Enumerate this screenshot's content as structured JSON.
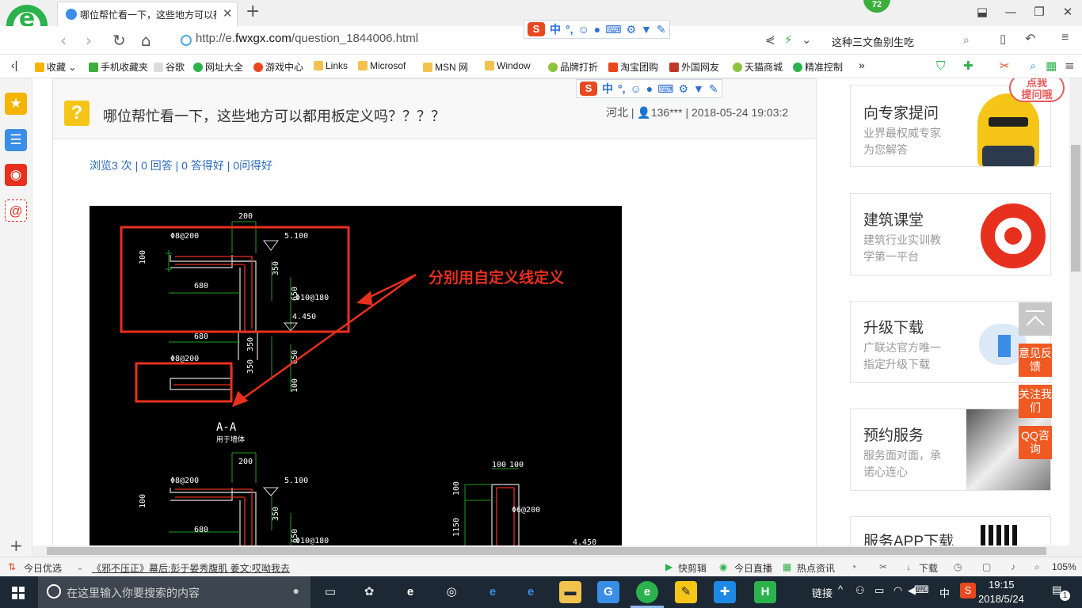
{
  "browser": {
    "tab_title": "哪位帮忙看一下，这些地方可以都用板定义吗？？？？",
    "tab_close": "✕",
    "new_tab": "+",
    "badge_count": "72",
    "url_scheme": "http://e.",
    "url_domain": "fwxgx.com",
    "url_path": "/question_1844006.html",
    "search_text": "这种三文鱼别生吃",
    "window_controls": [
      "⬓",
      "—",
      "❐",
      "✕"
    ]
  },
  "ime": {
    "logo": "S",
    "lang": "中",
    "punct": "°,",
    "icons": [
      "☺",
      "🎤",
      "⌨",
      "⚙",
      "👕",
      "🔧"
    ]
  },
  "bookmarks": [
    {
      "label": "收藏",
      "color": "#f5b400"
    },
    {
      "label": "手机收藏夹",
      "color": "#3cae3c"
    },
    {
      "label": "谷歌",
      "color": "#bbbbbb"
    },
    {
      "label": "网址大全",
      "color": "#2bb24c"
    },
    {
      "label": "游戏中心",
      "color": "#e8481f"
    },
    {
      "label": "Links",
      "color": "#f2c14e"
    },
    {
      "label": "Microsof",
      "color": "#f2c14e"
    },
    {
      "label": "MSN 网",
      "color": "#f2c14e"
    },
    {
      "label": "Window",
      "color": "#f2c14e"
    },
    {
      "label": "品牌打折",
      "color": "#8cc43e"
    },
    {
      "label": "淘宝团购",
      "color": "#e8481f"
    },
    {
      "label": "外国网友",
      "color": "#c0392b"
    },
    {
      "label": "天猫商城",
      "color": "#8cc43e"
    },
    {
      "label": "精准控制",
      "color": "#2bb24c"
    }
  ],
  "bookmarks_more": "»",
  "question": {
    "icon": "?",
    "title": "哪位帮忙看一下，这些地方可以都用板定义吗？？？？",
    "meta": "河北 | 👤136*** | 2018-05-24 19:03:2",
    "stats": "浏览3 次 | 0 回答 | 0 答得好 | 0问得好"
  },
  "drawing": {
    "annotation": "分别用自定义线定义",
    "section_label": "A-A",
    "section_sub": "用于墙体",
    "dims": {
      "top_200": "200",
      "elev_5100": "5.100",
      "rebar_8_200": "Φ8@200",
      "dim_100": "100",
      "dim_350": "350",
      "dim_680": "680",
      "dim_650": "650",
      "rebar_10_180": "Φ10@180",
      "elev_4450": "4.450",
      "dim_1150": "1150",
      "rebar_6_200": "Φ6@200",
      "elev_4450b": "4.450"
    }
  },
  "right_cards": [
    {
      "title": "向专家提问",
      "desc1": "业界最权威专家",
      "desc2": "为您解答",
      "color": "#f5c518"
    },
    {
      "title": "建筑课堂",
      "desc1": "建筑行业实训教",
      "desc2": "学第一平台",
      "color": "#e8301e"
    },
    {
      "title": "升级下载",
      "desc1": "广联达官方唯一",
      "desc2": "指定升级下载",
      "color": "#3a8ee6"
    },
    {
      "title": "预约服务",
      "desc1": "服务面对面，承",
      "desc2": "诺心连心",
      "color": "#8a8a8a"
    },
    {
      "title": "服务APP下载",
      "desc1": "",
      "desc2": "",
      "color": "#111111"
    }
  ],
  "tip_bubble": "点我\n提问哦",
  "side_buttons": [
    {
      "label": "意见反馈"
    },
    {
      "label": "关注我们"
    },
    {
      "label": "QQ咨询"
    }
  ],
  "statusbar": {
    "left": "今日优选",
    "news": "《邪不压正》幕后:彭于晏秀腹肌 姜文:哎呦我去",
    "items": [
      "快剪辑",
      "今日直播",
      "热点资讯"
    ],
    "download": "下载",
    "zoom": "105%"
  },
  "taskbar": {
    "search_placeholder": "在这里输入你要搜索的内容",
    "tray_link": "链接",
    "ime_lang": "中",
    "time": "19:15",
    "date": "2018/5/24",
    "notify_count": "1"
  }
}
